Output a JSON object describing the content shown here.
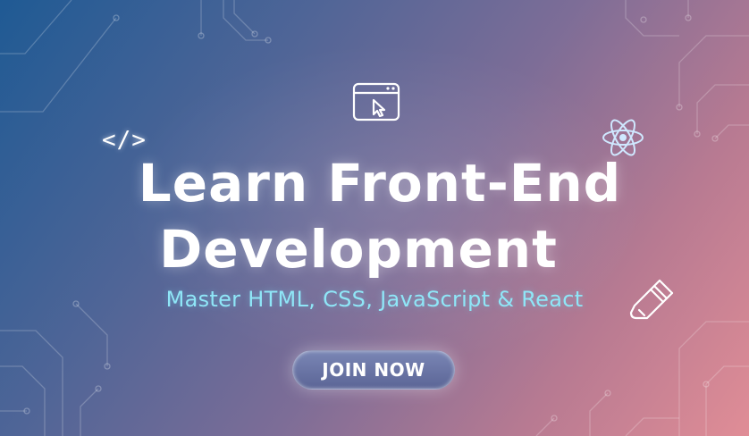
{
  "banner": {
    "title_line1": "Learn Front-End",
    "title_line2": "Development",
    "subtitle": "Master HTML, CSS, JavaScript & React",
    "cta_label": "JOIN NOW",
    "code_glyph": "</>"
  },
  "icons": [
    "code-tag-icon",
    "browser-window-icon",
    "atom-icon",
    "pen-tool-icon"
  ],
  "colors": {
    "background_start": "#1f5a94",
    "background_end": "#e08d96",
    "title": "#ffffff",
    "subtitle": "#8fe6f7",
    "button": "#6a74a6"
  }
}
